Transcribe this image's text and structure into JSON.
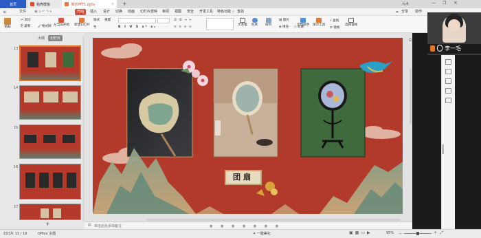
{
  "tabs": {
    "home": "首页",
    "template": "稻壳模板",
    "file": "演示PPT1.pptx"
  },
  "window": {
    "user": "九木",
    "share": "分享",
    "collab": "协作"
  },
  "menu": {
    "items": [
      "文件",
      "开始",
      "插入",
      "设计",
      "切换",
      "动画",
      "幻灯片放映",
      "审阅",
      "视图",
      "安全",
      "开发工具",
      "特色功能",
      "查找"
    ]
  },
  "ribbon": {
    "paste": "粘贴",
    "cut": "剪切",
    "copy": "复制",
    "format_painter": "格式刷",
    "from_current": "从当前开始",
    "new_slide": "新建幻灯片",
    "layout": "版式",
    "section": "节",
    "reset": "重置",
    "textbox": "文本框",
    "shape": "形状",
    "arrange": "排列",
    "image": "图片",
    "fill": "填充",
    "outline": "轮廓",
    "text_tools": "文档助手",
    "presentation_tools": "演示工具",
    "find": "查找",
    "replace": "替换",
    "select_pane": "选择窗格"
  },
  "leftpanel": {
    "tab_outline": "大纲",
    "tab_slides": "幻灯片",
    "slide_numbers": [
      "13",
      "14",
      "15",
      "16",
      "17"
    ],
    "add": "+"
  },
  "slide": {
    "caption": "团扇"
  },
  "notes": {
    "placeholder": "单击此处添加备注"
  },
  "status": {
    "slide_info": "幻灯片 13 / 19",
    "theme": "Office 主题",
    "beautify": "一键美化",
    "zoom": "95%"
  },
  "webcam": {
    "name": "李一毛"
  },
  "colors": {
    "slide_bg": "#b23a2a",
    "accent": "#c9553c",
    "home_tab": "#2c5cc5"
  }
}
